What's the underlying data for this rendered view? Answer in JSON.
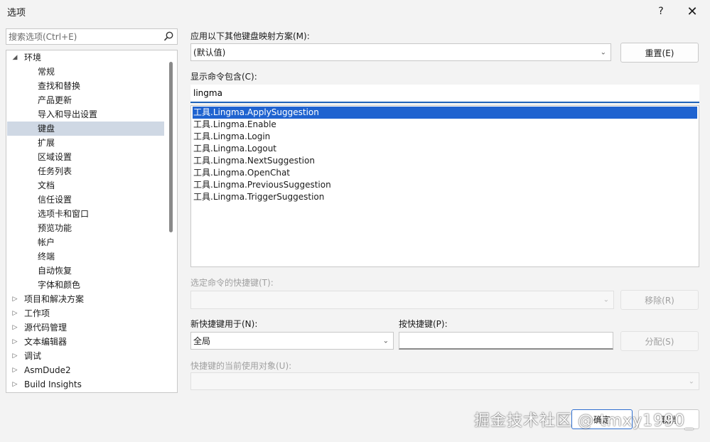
{
  "window": {
    "title": "选项",
    "help_label": "?",
    "close_label": "✕"
  },
  "search": {
    "placeholder": "搜索选项(Ctrl+E)"
  },
  "tree": {
    "items": [
      {
        "label": "环境",
        "level": 0,
        "expanded": true
      },
      {
        "label": "常规",
        "level": 1
      },
      {
        "label": "查找和替换",
        "level": 1
      },
      {
        "label": "产品更新",
        "level": 1
      },
      {
        "label": "导入和导出设置",
        "level": 1
      },
      {
        "label": "键盘",
        "level": 1,
        "selected": true
      },
      {
        "label": "扩展",
        "level": 1
      },
      {
        "label": "区域设置",
        "level": 1
      },
      {
        "label": "任务列表",
        "level": 1
      },
      {
        "label": "文档",
        "level": 1
      },
      {
        "label": "信任设置",
        "level": 1
      },
      {
        "label": "选项卡和窗口",
        "level": 1
      },
      {
        "label": "预览功能",
        "level": 1
      },
      {
        "label": "帐户",
        "level": 1
      },
      {
        "label": "终端",
        "level": 1
      },
      {
        "label": "自动恢复",
        "level": 1
      },
      {
        "label": "字体和颜色",
        "level": 1
      },
      {
        "label": "项目和解决方案",
        "level": 0,
        "expanded": false
      },
      {
        "label": "工作项",
        "level": 0,
        "expanded": false
      },
      {
        "label": "源代码管理",
        "level": 0,
        "expanded": false
      },
      {
        "label": "文本编辑器",
        "level": 0,
        "expanded": false
      },
      {
        "label": "调试",
        "level": 0,
        "expanded": false
      },
      {
        "label": "AsmDude2",
        "level": 0,
        "expanded": false
      },
      {
        "label": "Build Insights",
        "level": 0,
        "expanded": false
      }
    ]
  },
  "mapping": {
    "label": "应用以下其他键盘映射方案(M):",
    "value": "(默认值)",
    "reset_label": "重置(E)"
  },
  "commands": {
    "label": "显示命令包含(C):",
    "filter_value": "lingma",
    "items": [
      "工具.Lingma.ApplySuggestion",
      "工具.Lingma.Enable",
      "工具.Lingma.Login",
      "工具.Lingma.Logout",
      "工具.Lingma.NextSuggestion",
      "工具.Lingma.OpenChat",
      "工具.Lingma.PreviousSuggestion",
      "工具.Lingma.TriggerSuggestion"
    ],
    "selected_index": 0
  },
  "shortcuts": {
    "label": "选定命令的快捷键(T):",
    "value": "",
    "remove_label": "移除(R)"
  },
  "new_shortcut": {
    "scope_label": "新快捷键用于(N):",
    "scope_value": "全局",
    "press_label": "按快捷键(P):",
    "press_value": "",
    "assign_label": "分配(S)"
  },
  "usage": {
    "label": "快捷键的当前使用对象(U):",
    "value": ""
  },
  "footer": {
    "ok_label": "确定",
    "cancel_label": "取消",
    "watermark": "掘金技术社区 @ tmxy1990_"
  },
  "colors": {
    "accent": "#1f63d0",
    "selection_tree": "#cfd8e4"
  }
}
